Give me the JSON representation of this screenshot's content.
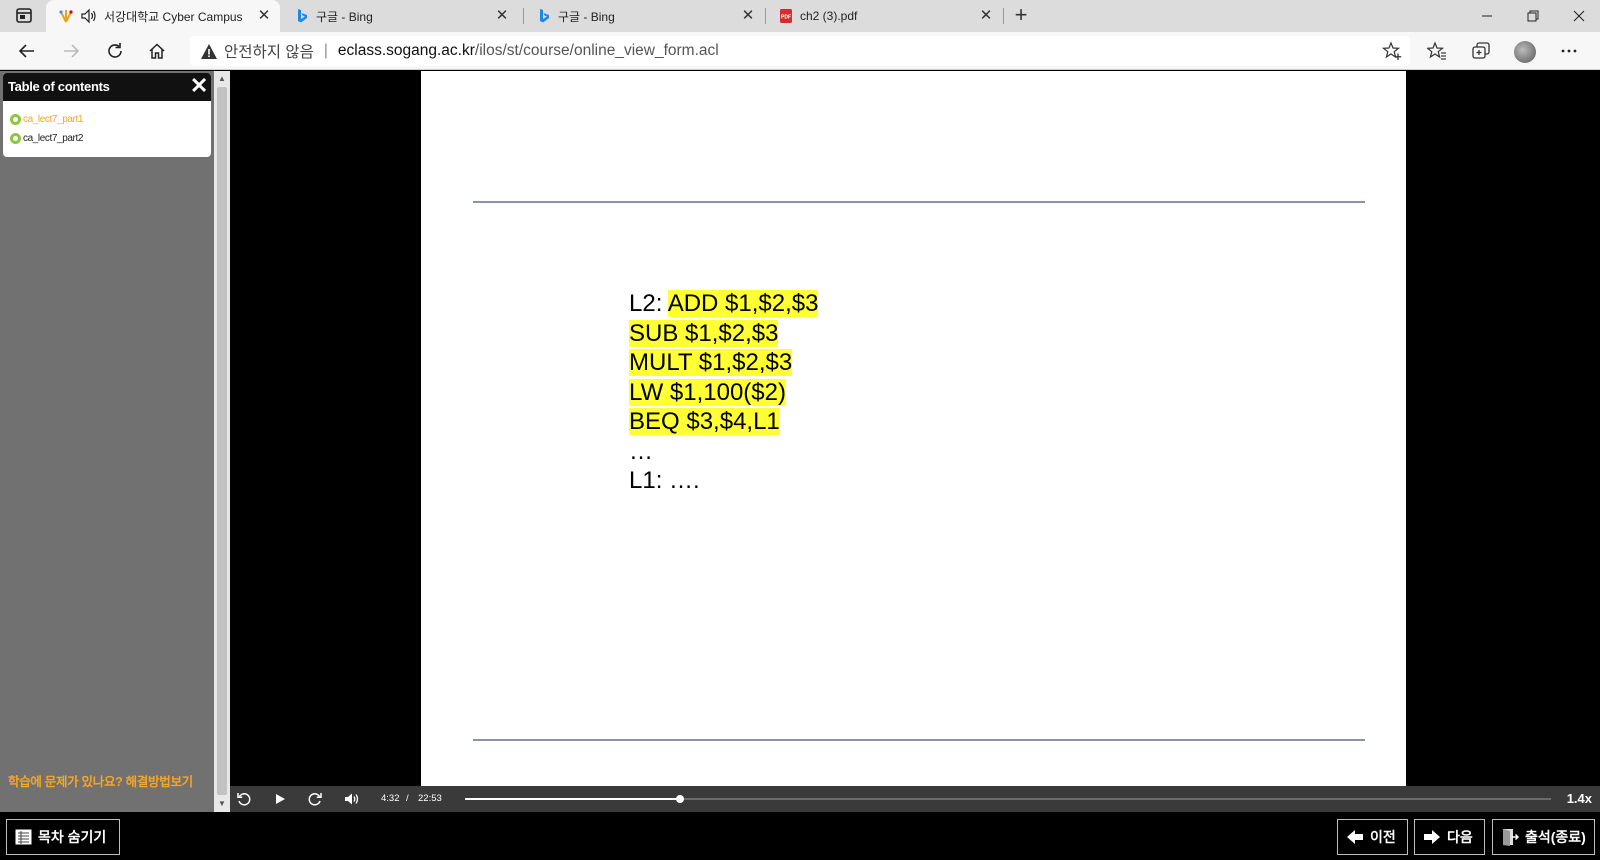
{
  "browser": {
    "tabs": [
      {
        "title": "서강대학교 Cyber Campus",
        "icon": "sogang-logo-icon",
        "active": true
      },
      {
        "title": "구글 - Bing",
        "icon": "bing-icon",
        "active": false
      },
      {
        "title": "구글 - Bing",
        "icon": "bing-icon",
        "active": false
      },
      {
        "title": "ch2 (3).pdf",
        "icon": "pdf-icon",
        "active": false
      }
    ],
    "new_tab_label": "+",
    "address": {
      "security_text": "안전하지 않음",
      "host": "eclass.sogang.ac.kr",
      "path": "/ilos/st/course/online_view_form.acl"
    }
  },
  "toc": {
    "title": "Table of contents",
    "items": [
      {
        "label": "ca_lect7_part1",
        "current": true
      },
      {
        "label": "ca_lect7_part2",
        "current": false
      }
    ],
    "help_link": "학습에 문제가 있나요? 해결방법보기"
  },
  "slide": {
    "lines": [
      {
        "label": "L2: ",
        "code": "ADD $1,$2,$3"
      },
      {
        "label": "",
        "code": "SUB $1,$2,$3"
      },
      {
        "label": "",
        "code": "MULT $1,$2,$3"
      },
      {
        "label": "",
        "code": "LW $1,100($2)"
      },
      {
        "label": "",
        "code": "BEQ $3,$4,L1"
      },
      {
        "label": "…",
        "code": ""
      },
      {
        "label": "L1: ….",
        "code": ""
      }
    ],
    "highlight_color": "#ffff33"
  },
  "player": {
    "current_time": "4:32",
    "time_separator": "/",
    "duration": "22:53",
    "progress_fraction": 0.198,
    "speed": "1.4x"
  },
  "bottom": {
    "toggle_toc": "목차 숨기기",
    "prev": "이전",
    "next": "다음",
    "attendance": "출석(종료)"
  },
  "colors": {
    "accent_orange": "#f5a623",
    "toc_dot_green": "#8dc63f"
  }
}
